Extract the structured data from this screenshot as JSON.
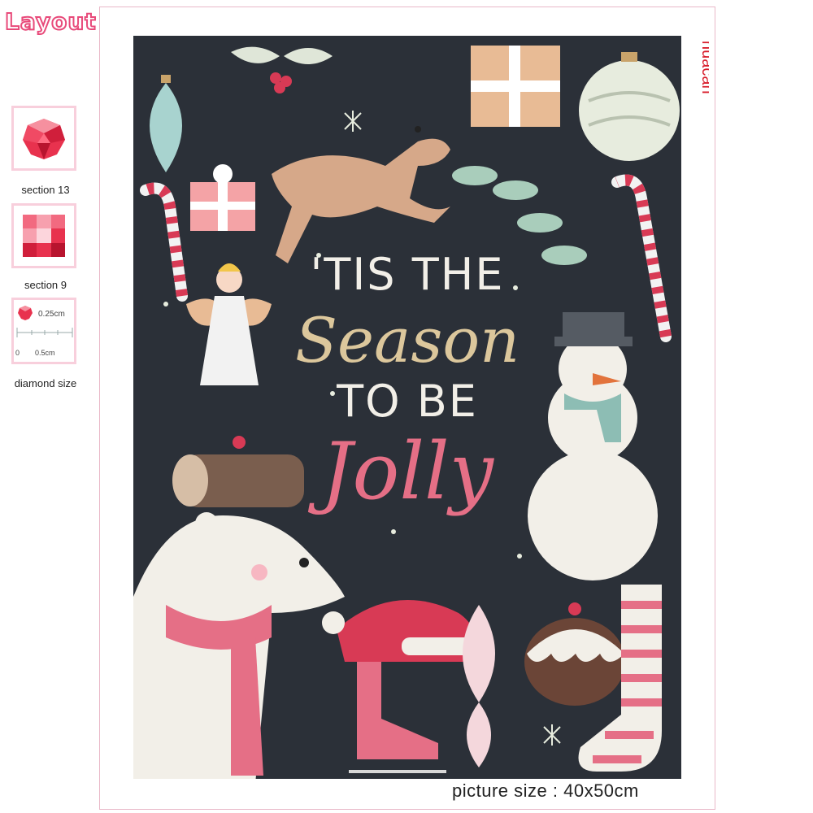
{
  "header": {
    "title": "Layout"
  },
  "swatches": [
    {
      "label": "section 13"
    },
    {
      "label": "section 9"
    },
    {
      "label": "diamond size",
      "measure_top": "0.25cm",
      "ruler_start": "0",
      "ruler_end": "0.5cm"
    }
  ],
  "artwork": {
    "line1": "'TIS THE",
    "line2": "Season",
    "line3": "TO BE",
    "line4": "Jolly",
    "background_color": "#2b3038"
  },
  "brand": {
    "name": "huacan",
    "color": "#d81e2c"
  },
  "footer": {
    "picture_size": "picture size : 40x50cm"
  },
  "colors": {
    "accent_pink": "#e84a7a",
    "border_pink": "#f8cfdc"
  }
}
